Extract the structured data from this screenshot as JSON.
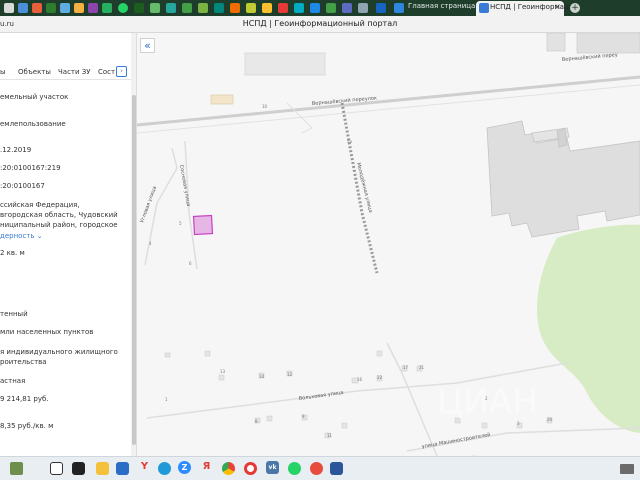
{
  "browser": {
    "tabs": [
      {
        "label": "Главная страница"
      },
      {
        "label": "НСПД | Геоинформаци"
      }
    ],
    "url_fragment": "u.ru",
    "page_title": "НСПД | Геоинформационный портал",
    "new_tab_label": "+"
  },
  "panel": {
    "tabs": [
      {
        "label": "ы"
      },
      {
        "label": "Объекты"
      },
      {
        "label": "Части ЗУ"
      },
      {
        "label": "Сост"
      }
    ],
    "tab_scroll_label": "›",
    "values": [
      "емельный участок",
      "емлепользование",
      ".12.2019",
      ":20:0100167:219",
      ":20:0100167",
      "ссийская Федерация,",
      "вгородская область, Чудовский",
      "ниципальный район, городское",
      "дерность",
      "2 кв. м",
      "тенный",
      "мли населенных пунктов",
      "я индивидуального жилищного",
      "роительства",
      "астная",
      "9 214,81 руб.",
      "8,35 руб./кв. м"
    ],
    "expand_glyph": "⌄"
  },
  "map": {
    "collapse_glyph": "«",
    "streets": [
      "Вернашёвский переулок",
      "Вернашёвский переу",
      "Сосновая улица",
      "Угловая улица",
      "Молодёжная улица",
      "Вольховая улица",
      "улица Машиностроителей"
    ],
    "watermark": "ЦИАН",
    "selected_parcel_color": "#c93fc4",
    "greenery_color": "#d7ecc4",
    "house_numbers": [
      "5",
      "4",
      "6",
      "10",
      "12",
      "14",
      "13",
      "16",
      "17",
      "21",
      "22",
      "1",
      "2",
      "3",
      "8",
      "9",
      "11",
      "5а",
      "20"
    ]
  },
  "taskbar": {
    "icons": [
      "start-icon",
      "desktop-icon",
      "task-view-icon",
      "folder-icon",
      "mail-icon",
      "yandex-icon",
      "edge-icon",
      "zoom-icon",
      "ya-icon",
      "chrome-icon",
      "opera-icon",
      "vk-icon",
      "whatsapp-icon",
      "browser-icon",
      "word-icon"
    ],
    "glyphs": {
      "yandex": "Y",
      "zoom": "Z",
      "ya": "Я",
      "vk": "vk"
    }
  }
}
